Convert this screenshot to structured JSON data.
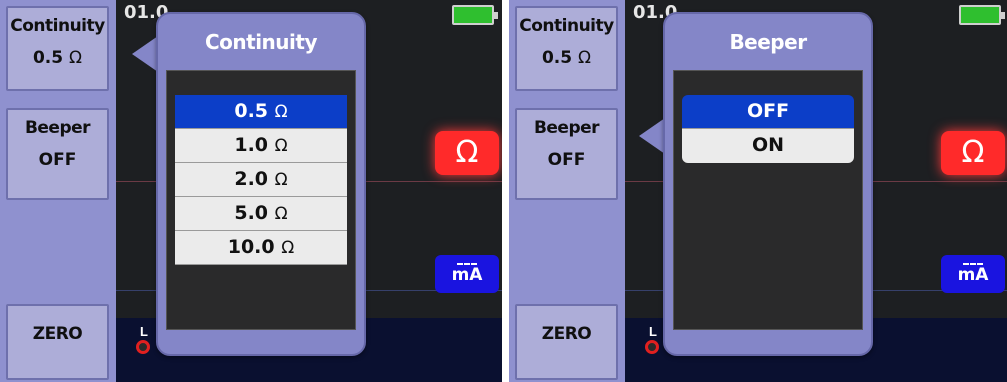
{
  "left_screen": {
    "softkeys": {
      "continuity": {
        "title": "Continuity",
        "value": "0.5",
        "unit": "Ω"
      },
      "beeper": {
        "title": "Beeper",
        "value": "OFF"
      },
      "zero": {
        "title": "ZERO"
      }
    },
    "status": {
      "datetime": "01.0"
    },
    "badges": {
      "ohm": "Ω",
      "ma": "mA"
    },
    "terminal_label": "L",
    "popup": {
      "title": "Continuity",
      "options": [
        {
          "value": "0.5",
          "unit": "Ω",
          "selected": true
        },
        {
          "value": "1.0",
          "unit": "Ω",
          "selected": false
        },
        {
          "value": "2.0",
          "unit": "Ω",
          "selected": false
        },
        {
          "value": "5.0",
          "unit": "Ω",
          "selected": false
        },
        {
          "value": "10.0",
          "unit": "Ω",
          "selected": false
        }
      ]
    }
  },
  "right_screen": {
    "softkeys": {
      "continuity": {
        "title": "Continuity",
        "value": "0.5",
        "unit": "Ω"
      },
      "beeper": {
        "title": "Beeper",
        "value": "OFF"
      },
      "zero": {
        "title": "ZERO"
      }
    },
    "status": {
      "datetime": "01.0"
    },
    "badges": {
      "ohm": "Ω",
      "ma": "mA"
    },
    "terminal_label": "L",
    "popup": {
      "title": "Beeper",
      "options": [
        {
          "value": "OFF",
          "selected": true
        },
        {
          "value": "ON",
          "selected": false
        }
      ]
    }
  },
  "colors": {
    "softkey_bg": "#8f91cf",
    "popup_bg": "#8486c8",
    "selected": "#0c3ec8",
    "ohm_badge": "#ff2a2a",
    "ma_badge": "#1a14e0",
    "battery": "#2fbf2f"
  },
  "icons": [
    "battery-icon",
    "ohm-icon",
    "milliamp-icon",
    "terminal-icon"
  ]
}
